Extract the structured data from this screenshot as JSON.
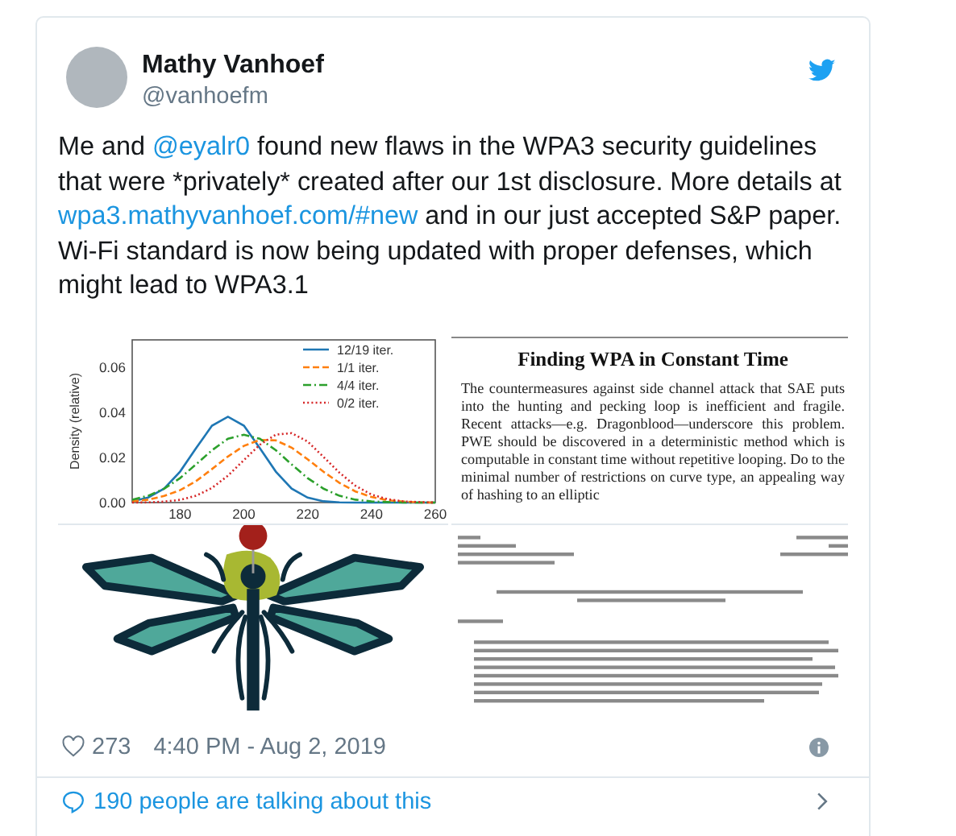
{
  "author": {
    "name": "Mathy Vanhoef",
    "handle": "@vanhoefm"
  },
  "tweet_text": [
    {
      "kind": "text",
      "text": "Me and "
    },
    {
      "kind": "mention",
      "text": "@eyalr0"
    },
    {
      "kind": "text",
      "text": " found new flaws in the WPA3 security guidelines that were *privately* created after our 1st disclosure. More details at "
    },
    {
      "kind": "link",
      "text": "wpa3.mathyvanhoef.com/#new"
    },
    {
      "kind": "text",
      "text": " and in our just accepted S&P paper. Wi-Fi standard is now being updated with proper defenses, which might lead to WPA3.1"
    }
  ],
  "media": [
    {
      "kind": "chart",
      "chart_data": {
        "type": "line",
        "ylabel": "Density (relative)",
        "x": [
          165,
          170,
          175,
          180,
          185,
          190,
          195,
          200,
          205,
          210,
          215,
          220,
          225,
          230,
          235,
          240,
          245,
          250,
          255,
          260
        ],
        "xlim": [
          165,
          260
        ],
        "ylim": [
          0,
          0.072
        ],
        "legend": "upper right",
        "xticks": [
          180,
          200,
          220,
          240,
          260
        ],
        "yticks": [
          {
            "value": 0,
            "label": "0.00"
          },
          {
            "value": 0.02,
            "label": "0.02"
          },
          {
            "value": 0.04,
            "label": "0.04"
          },
          {
            "value": 0.06,
            "label": "0.06"
          }
        ],
        "series": [
          {
            "name": "12/19 iter.",
            "color": "#1f77b4",
            "line_style": "solid",
            "values": [
              0.0006,
              0.0022,
              0.0062,
              0.0137,
              0.024,
              0.034,
              0.038,
              0.034,
              0.024,
              0.0137,
              0.0062,
              0.0022,
              0.0006,
              0.0001,
              0,
              0,
              0,
              0,
              0,
              0
            ]
          },
          {
            "name": "1/1 iter.",
            "color": "#ff7f0e",
            "line_style": "dashed",
            "values": [
              0.0006,
              0.0013,
              0.0029,
              0.0055,
              0.0095,
              0.0148,
              0.0204,
              0.0251,
              0.0277,
              0.0275,
              0.0243,
              0.0192,
              0.0136,
              0.0087,
              0.0049,
              0.0025,
              0.0011,
              0.0004,
              0.0001,
              0
            ]
          },
          {
            "name": "4/4 iter.",
            "color": "#2ca02c",
            "line_style": "dashdot",
            "values": [
              0.0013,
              0.003,
              0.0061,
              0.0108,
              0.0169,
              0.0232,
              0.0282,
              0.03,
              0.0282,
              0.0232,
              0.0169,
              0.0108,
              0.0061,
              0.003,
              0.0013,
              0.0005,
              0.0002,
              0,
              0,
              0
            ]
          },
          {
            "name": "0/2 iter.",
            "color": "#d62728",
            "line_style": "dotted",
            "values": [
              0,
              0.0001,
              0.0004,
              0.0012,
              0.003,
              0.0065,
              0.0119,
              0.0188,
              0.0256,
              0.0301,
              0.0307,
              0.027,
              0.0202,
              0.0132,
              0.0074,
              0.0036,
              0.0015,
              0.0005,
              0.0002,
              0
            ]
          }
        ]
      }
    },
    {
      "kind": "paper",
      "title": "Finding WPA in Constant Time",
      "body": "The countermeasures against side channel attack that SAE puts into the hunting and pecking loop is inefficient and fragile. Recent attacks—e.g. Dragonblood—underscore this problem. PWE should be discovered in a deterministic method which is computable in constant time without repetitive looping. Do to the minimal number of restrictions on curve type, an appealing way of hashing to an elliptic"
    },
    {
      "kind": "logo"
    },
    {
      "kind": "document"
    }
  ],
  "likes": "273",
  "timestamp": "4:40 PM - Aug 2, 2019",
  "conversation": "190 people are talking about this"
}
